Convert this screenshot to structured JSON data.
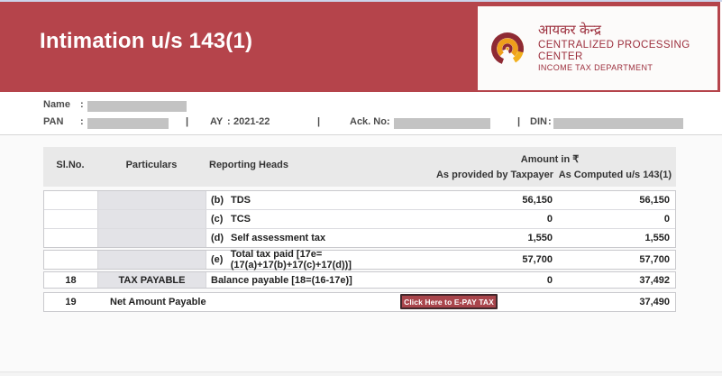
{
  "colors": {
    "banner_red": "#b5444b",
    "button_red": "#a9454c",
    "logo_maroon": "#9c2e3c",
    "logo_orange": "#f0a21a"
  },
  "header": {
    "title": "Intimation u/s 143(1)",
    "logo": {
      "hindi": "आयकर केन्द्र",
      "line1": "CENTRALIZED PROCESSING CENTER",
      "line2": "INCOME TAX DEPARTMENT"
    }
  },
  "info": {
    "colon": ":",
    "sep": "|",
    "name_label": "Name",
    "pan_label": "PAN",
    "ay_label": "AY",
    "ay_value": "2021-22",
    "ack_label": "Ack. No.",
    "din_label": "DIN"
  },
  "table": {
    "headers": {
      "slno": "Sl.No.",
      "particulars": "Particulars",
      "reporting_heads": "Reporting Heads",
      "amount_group": "Amount in ₹",
      "col_taxpayer": "As provided by Taxpayer",
      "col_computed": "As Computed u/s 143(1)"
    },
    "rows": [
      {
        "code": "(b)",
        "head": "TDS",
        "taxpayer": "56,150",
        "computed": "56,150"
      },
      {
        "code": "(c)",
        "head": "TCS",
        "taxpayer": "0",
        "computed": "0"
      },
      {
        "code": "(d)",
        "head": "Self assessment tax",
        "taxpayer": "1,550",
        "computed": "1,550"
      },
      {
        "code": "(e)",
        "head": "Total tax paid [17e=(17(a)+17(b)+17(c)+17(d))]",
        "taxpayer": "57,700",
        "computed": "57,700"
      },
      {
        "slno": "18",
        "particulars": "TAX PAYABLE",
        "head": "Balance payable [18=(16-17e)]",
        "taxpayer": "0",
        "computed": "37,492"
      },
      {
        "slno": "19",
        "particulars": "Net Amount Payable",
        "computed": "37,490"
      }
    ]
  },
  "button": {
    "epay_label": "Click Here to E-PAY TAX"
  }
}
